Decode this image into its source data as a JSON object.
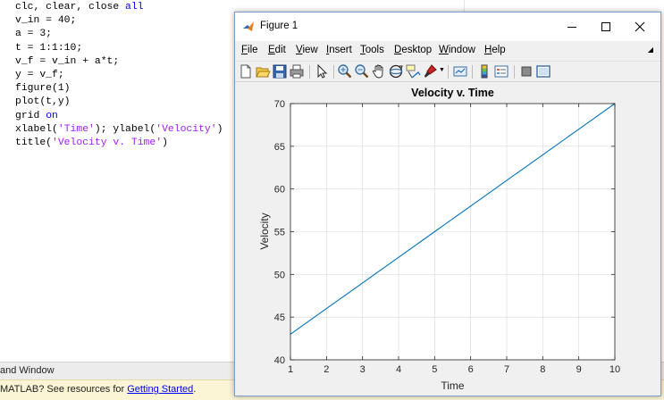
{
  "editor": {
    "lines": [
      [
        {
          "t": "clc, clear, close "
        },
        {
          "t": "all",
          "c": "kw"
        }
      ],
      [
        {
          "t": "v_in = 40;"
        }
      ],
      [
        {
          "t": "a = 3;"
        }
      ],
      [
        {
          "t": "t = 1:1:10;"
        }
      ],
      [
        {
          "t": "v_f = v_in + a*t;"
        }
      ],
      [
        {
          "t": "y = v_f;"
        }
      ],
      [
        {
          "t": "figure(1)"
        }
      ],
      [
        {
          "t": "plot(t,y)"
        }
      ],
      [
        {
          "t": "grid "
        },
        {
          "t": "on",
          "c": "kw"
        }
      ],
      [
        {
          "t": "xlabel("
        },
        {
          "t": "'Time'",
          "c": "str"
        },
        {
          "t": "); ylabel("
        },
        {
          "t": "'Velocity'",
          "c": "str"
        },
        {
          "t": ")"
        }
      ],
      [
        {
          "t": "title("
        },
        {
          "t": "'Velocity v. Time'",
          "c": "str"
        },
        {
          "t": ")"
        }
      ]
    ]
  },
  "command_window": {
    "title": "and Window",
    "message_prefix": "MATLAB? See resources for ",
    "link": "Getting Started",
    "message_suffix": "."
  },
  "figure": {
    "window_title": "Figure 1",
    "menus": [
      "File",
      "Edit",
      "View",
      "Insert",
      "Tools",
      "Desktop",
      "Window",
      "Help"
    ],
    "toolbar_icons": [
      "new-figure-icon",
      "open-file-icon",
      "save-icon",
      "print-icon",
      "select-arrow-icon",
      "zoom-in-icon",
      "zoom-out-icon",
      "pan-hand-icon",
      "rotate-3d-icon",
      "data-cursor-icon",
      "brush-icon",
      "link-plot-icon",
      "insert-colorbar-icon",
      "insert-legend-icon",
      "hide-plot-tools-icon",
      "show-plot-tools-icon"
    ],
    "colors": {
      "line": "#0072bd",
      "grid": "#d9d9d9",
      "titlebar": "#ffffff",
      "chrome": "#f0f0f0"
    }
  },
  "chart_data": {
    "type": "line",
    "title": "Velocity v. Time",
    "xlabel": "Time",
    "ylabel": "Velocity",
    "xlim": [
      1,
      10
    ],
    "ylim": [
      40,
      70
    ],
    "xticks": [
      1,
      2,
      3,
      4,
      5,
      6,
      7,
      8,
      9,
      10
    ],
    "yticks": [
      40,
      45,
      50,
      55,
      60,
      65,
      70
    ],
    "grid": true,
    "series": [
      {
        "x": [
          1,
          2,
          3,
          4,
          5,
          6,
          7,
          8,
          9,
          10
        ],
        "y": [
          43,
          46,
          49,
          52,
          55,
          58,
          61,
          64,
          67,
          70
        ],
        "color": "#0072bd"
      }
    ]
  }
}
